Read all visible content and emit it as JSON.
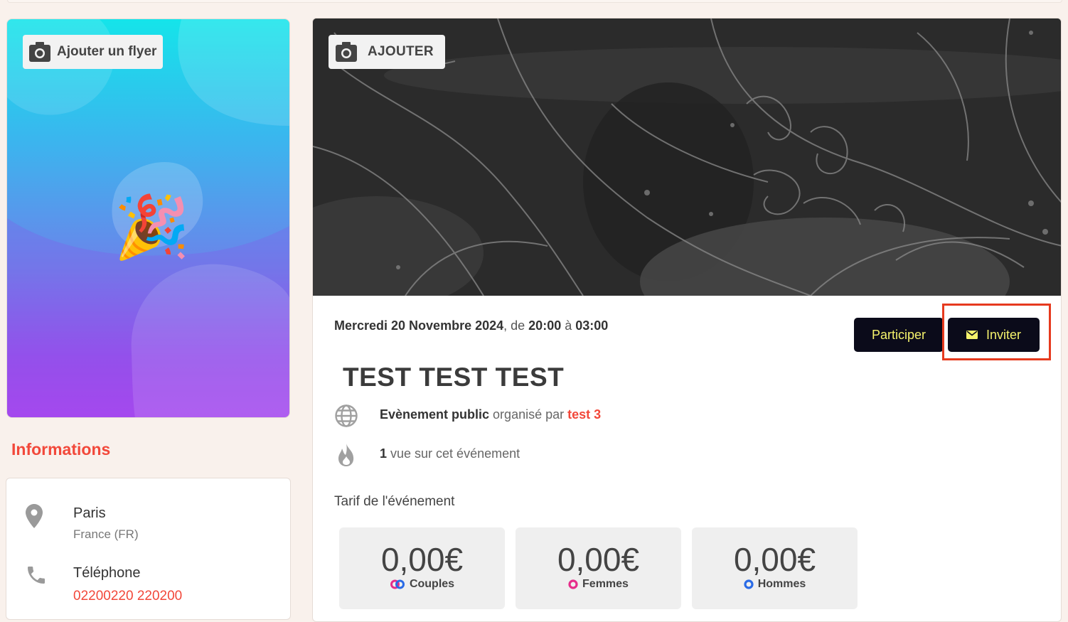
{
  "flyer": {
    "add_label": "Ajouter un flyer",
    "emoji": "🎉"
  },
  "info": {
    "title": "Informations",
    "location_city": "Paris",
    "location_country": "France (FR)",
    "phone_label": "Téléphone",
    "phone_value": "02200220 220200"
  },
  "cover": {
    "add_label": "AJOUTER"
  },
  "event": {
    "date": "Mercredi 20 Novembre 2024",
    "from_word": ", de ",
    "start": "20:00",
    "to_word": " à ",
    "end": "03:00",
    "title": "TEST TEST TEST",
    "visibility": "Evènement public",
    "organised_by": " organisé par ",
    "organiser": "test 3",
    "views_count": "1",
    "views_text": " vue sur cet événement",
    "tarif_label": "Tarif de l'événement"
  },
  "actions": {
    "participate": "Participer",
    "invite": "Inviter"
  },
  "prices": [
    {
      "amount": "0,00€",
      "label": "Couples"
    },
    {
      "amount": "0,00€",
      "label": "Femmes"
    },
    {
      "amount": "0,00€",
      "label": "Hommes"
    }
  ],
  "colors": {
    "accent": "#f2483a",
    "button_bg": "#0b0b1a",
    "button_text": "#f5f26c",
    "highlight": "#e63a1e"
  }
}
